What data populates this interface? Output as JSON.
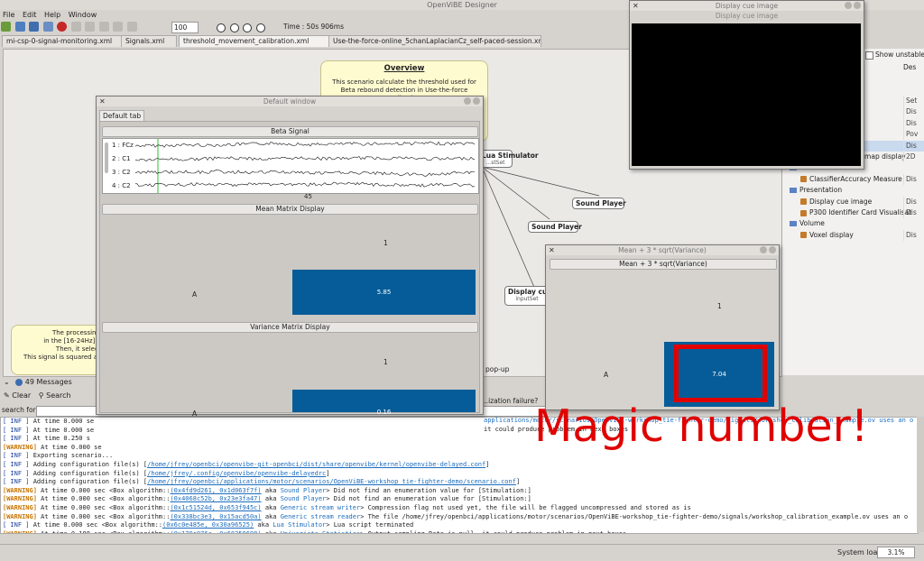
{
  "app": {
    "title": "OpenViBE Designer",
    "menu": [
      "File",
      "Edit",
      "Help",
      "Window"
    ],
    "zoom": "100",
    "time_label": "Time : 50s 906ms",
    "tabs": [
      "mi-csp-0-signal-monitoring.xml",
      "Signals.xml",
      "threshold_movement_calibration.xml",
      "Use-the-force-online_5chanLaplacianCz_self-paced-session.xml"
    ]
  },
  "scenario": {
    "overview_title": "Overview",
    "overview_text": "This scenario calculate the threshold used for Beta rebound detection in Use-the-force application.",
    "note_lines": [
      "The processing c",
      "in the [16-24Hz] fre",
      "Then, it select \"",
      "This signal is squared and"
    ],
    "boxes": {
      "lua": "Lua Stimulator",
      "lua_sub": "...stSet",
      "sp1": "Sound Player",
      "sp2": "Sound Player",
      "dc": "Display cue i",
      "dc_sub": "inputSet"
    },
    "popup_lines": [
      "pop-up",
      "...ization failure?"
    ]
  },
  "right_panel": {
    "checkbox_label": "Show unstable",
    "header_col2": "Des",
    "rows": [
      {
        "label": "...gs example",
        "col2": "Set",
        "type": "plain"
      },
      {
        "label": "",
        "col2": "Dis",
        "type": "plain"
      },
      {
        "label": "",
        "col2": "Dis",
        "type": "plain"
      },
      {
        "label": "...splay",
        "col2": "Pov",
        "type": "plain"
      },
      {
        "label": "",
        "col2": "Dis",
        "type": "sel"
      },
      {
        "label": "Time-frequency map display",
        "col2": "2D",
        "type": "leaf"
      },
      {
        "label": "Classification",
        "col2": "",
        "type": "folder"
      },
      {
        "label": "ClassifierAccuracy Measure",
        "col2": "Dis",
        "type": "leaf"
      },
      {
        "label": "Presentation",
        "col2": "",
        "type": "folder"
      },
      {
        "label": "Display cue image",
        "col2": "Dis",
        "type": "leaf"
      },
      {
        "label": "P300 Identifier Card Visualisat",
        "col2": "Dis",
        "type": "leaf"
      },
      {
        "label": "Volume",
        "col2": "",
        "type": "folder"
      },
      {
        "label": "Voxel display",
        "col2": "Dis",
        "type": "leaf"
      }
    ]
  },
  "default_window": {
    "title": "Default window",
    "tab": "Default tab",
    "beta_title": "Beta Signal",
    "channels": [
      "1 : FCz",
      "2 : C1",
      "3 : C2",
      "4 : C2"
    ],
    "time_tick": "45",
    "mean_title": "Mean Matrix Display",
    "mean_col": "1",
    "mean_row": "A",
    "mean_value": "5.85",
    "var_title": "Variance Matrix Display",
    "var_col": "1",
    "var_row": "A",
    "var_value": "0.16"
  },
  "cue_window": {
    "title": "Display cue image",
    "inner_title": "Display cue image"
  },
  "mean_window": {
    "title": "Mean + 3 * sqrt(Variance)",
    "panel_title": "Mean + 3 * sqrt(Variance)",
    "col": "1",
    "row": "A",
    "value": "7.04"
  },
  "annotation": {
    "text": "Magic number!",
    "color": "#e00000"
  },
  "log": {
    "count_label": "49 Messages",
    "clear_label": "Clear",
    "search_label": "Search",
    "search_for_label": "search for:",
    "lines": [
      {
        "lvl": "INF",
        "pre": "At time 0.000 se",
        "addr": "",
        "mid": "",
        "bn": "",
        "post": ""
      },
      {
        "lvl": "INF",
        "pre": "At time 0.000 se",
        "addr": "",
        "mid": "",
        "bn": "",
        "post": ""
      },
      {
        "lvl": "INF",
        "pre": "At time 0.250 s",
        "addr": "",
        "mid": "",
        "bn": "",
        "post": ""
      },
      {
        "lvl": "WARNING",
        "pre": "At time 0.000 se",
        "addr": "",
        "mid": "",
        "bn": "",
        "post": ""
      },
      {
        "lvl": "INF",
        "pre": "Exporting scenario...",
        "addr": "",
        "mid": "",
        "bn": "",
        "post": ""
      },
      {
        "lvl": "INF",
        "pre": "Adding configuration file(s) [",
        "addr": "/home/jfrey/openbci/openvibe-git-openbci/dist/share/openvibe/kernel/openvibe-delayed.conf",
        "mid": "]",
        "bn": "",
        "post": ""
      },
      {
        "lvl": "INF",
        "pre": "Adding configuration file(s) [",
        "addr": "/home/jfrey/.config/openvibe/openvibe-delayedrc",
        "mid": "]",
        "bn": "",
        "post": ""
      },
      {
        "lvl": "INF",
        "pre": "Adding configuration file(s) [",
        "addr": "/home/jfrey/openbci/applications/motor/scenarios/OpenViBE-workshop_tie-fighter-demo/scenario.conf",
        "mid": "]",
        "bn": "",
        "post": ""
      },
      {
        "lvl": "WARNING",
        "pre": "At time 0.000 sec <Box algorithm::",
        "addr": "(0x4fd9d261, 0x1d063f7f)",
        "mid": " aka ",
        "bn": "Sound Player",
        "post": "> Did not find an enumeration value for [Stimulation:]"
      },
      {
        "lvl": "WARNING",
        "pre": "At time 0.000 sec <Box algorithm::",
        "addr": "(0x4068c52b, 0x23e3fa47)",
        "mid": " aka ",
        "bn": "Sound Player",
        "post": "> Did not find an enumeration value for [Stimulation:]"
      },
      {
        "lvl": "WARNING",
        "pre": "At time 0.000 sec <Box algorithm::",
        "addr": "(0x1c51524d, 0x653f945c)",
        "mid": " aka ",
        "bn": "Generic stream writer",
        "post": "> Compression flag not used yet, the file will be flagged uncompressed and stored as is"
      },
      {
        "lvl": "WARNING",
        "pre": "At time 0.000 sec <Box algorithm::",
        "addr": "(0x338bc3e3, 0x15acd50a)",
        "mid": " aka ",
        "bn": "Generic stream reader",
        "post": "> The file /home/jfrey/openbci/applications/motor/scenarios/OpenViBE-workshop_tie-fighter-demo/signals/workshop_calibration_example.ov uses an o"
      },
      {
        "lvl": "INF",
        "pre": "At time 0.000 sec <Box algorithm::",
        "addr": "(0x6c0e485e, 0x30a96525)",
        "mid": " aka ",
        "bn": "Lua Stimulator",
        "post": "> Lua script terminated"
      },
      {
        "lvl": "WARNING",
        "pre": "At time 0.188 sec <Box algorithm::",
        "addr": "(0x179e976c, 0x68259698)",
        "mid": " aka ",
        "bn": "Univariate Statistics",
        "post": "> Output sampling Rate is null, it could produce problem in next boxes"
      }
    ],
    "behind_lines": [
      "applications/motor/scenarios/OpenViBE-workshop_tie-fighter-demo/signals/workshop_calibration_example.ov uses an o",
      "",
      "it could produce problem in next boxes"
    ]
  },
  "status": {
    "load_label": "System load :",
    "load_value": "3.1%"
  }
}
